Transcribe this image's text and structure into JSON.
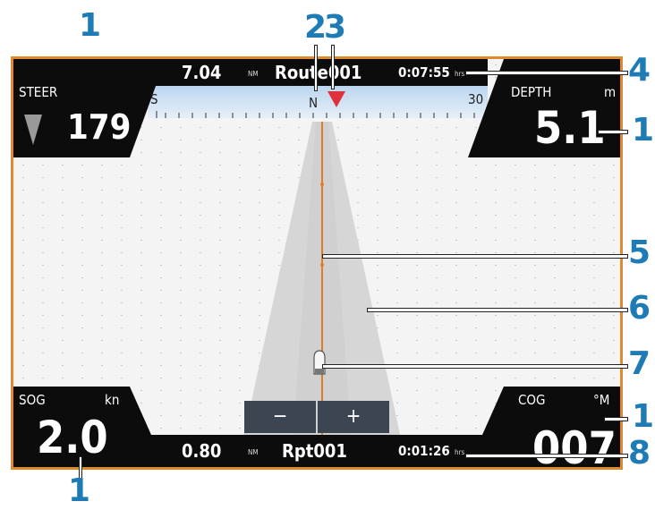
{
  "steer": {
    "label": "STEER",
    "value": "179"
  },
  "depth": {
    "label": "DEPTH",
    "unit": "m",
    "value": "5.1"
  },
  "sog": {
    "label": "SOG",
    "unit": "kn",
    "value": "2.0"
  },
  "cog": {
    "label": "COG",
    "unit": "°M",
    "value": "007"
  },
  "top_bar": {
    "distance": "7.04",
    "distance_unit": "NM",
    "route": "Route001",
    "time": "0:07:55",
    "time_unit": "hrs"
  },
  "bottom_bar": {
    "distance": "0.80",
    "distance_unit": "NM",
    "waypoint": "Rpt001",
    "time": "0:01:26",
    "time_unit": "hrs"
  },
  "compass": {
    "left": "S",
    "center": "N",
    "right": "30"
  },
  "zoom": {
    "minus": "−",
    "plus": "+"
  },
  "callouts": {
    "c1": "1",
    "c2": "2",
    "c3": "3",
    "c4": "4",
    "c5": "5",
    "c6": "6",
    "c7": "7",
    "c8": "8"
  },
  "colors": {
    "frame": "#e08a2e",
    "callout": "#1f7bb5",
    "track": "#e07b2a",
    "heading_marker": "#e0303a"
  }
}
